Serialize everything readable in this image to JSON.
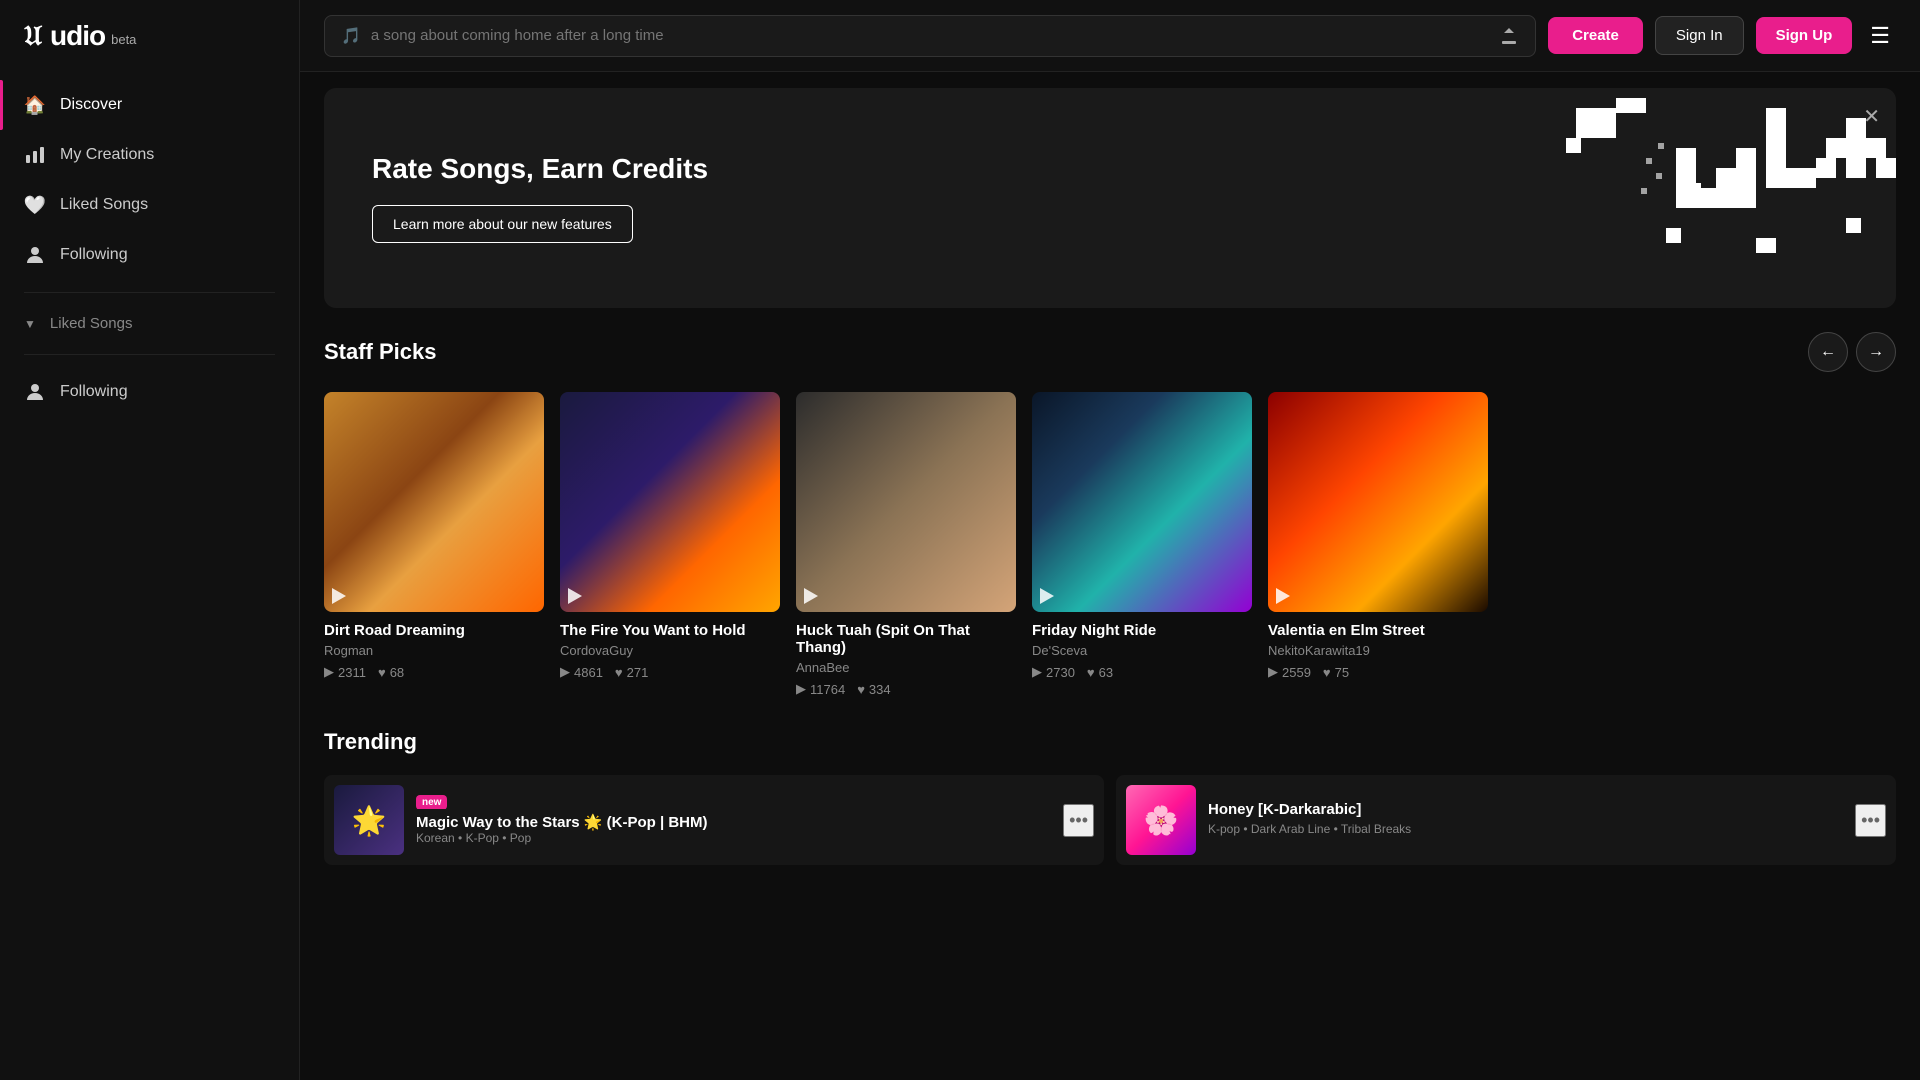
{
  "app": {
    "name": "udio",
    "badge": "beta"
  },
  "topbar": {
    "search_placeholder": "a song about coming home after a long time",
    "create_label": "Create",
    "signin_label": "Sign In",
    "signup_label": "Sign Up"
  },
  "sidebar": {
    "nav_items": [
      {
        "id": "discover",
        "label": "Discover",
        "icon": "🏠",
        "active": true
      },
      {
        "id": "my-creations",
        "label": "My Creations",
        "icon": "📊",
        "active": false
      },
      {
        "id": "liked-songs",
        "label": "Liked Songs",
        "icon": "🤍",
        "active": false
      },
      {
        "id": "following",
        "label": "Following",
        "icon": "👤",
        "active": false
      }
    ],
    "section_collapsed": {
      "label": "Liked Songs",
      "icon": "👤"
    },
    "following_sub": {
      "label": "Following",
      "icon": "👤"
    }
  },
  "hero": {
    "title": "Rate Songs, Earn Credits",
    "button_label": "Learn more about our new features"
  },
  "staff_picks": {
    "title": "Staff Picks",
    "cards": [
      {
        "title": "Dirt Road Dreaming",
        "artist": "Rogman",
        "plays": "2311",
        "likes": "68",
        "thumb_class": "thumb-1"
      },
      {
        "title": "The Fire You Want to Hold",
        "artist": "CordovaGuy",
        "plays": "4861",
        "likes": "271",
        "thumb_class": "thumb-2"
      },
      {
        "title": "Huck Tuah (Spit On That Thang)",
        "artist": "AnnaBee",
        "plays": "11764",
        "likes": "334",
        "thumb_class": "thumb-3"
      },
      {
        "title": "Friday Night Ride",
        "artist": "De'Sceva",
        "plays": "2730",
        "likes": "63",
        "thumb_class": "thumb-4"
      },
      {
        "title": "Valentia en Elm Street",
        "artist": "NekitoKarawita19",
        "plays": "2559",
        "likes": "75",
        "thumb_class": "thumb-5"
      }
    ]
  },
  "trending": {
    "title": "Trending",
    "items": [
      {
        "title": "Magic Way to the Stars 🌟 (K-Pop | BHM)",
        "is_new": true,
        "tags": "Korean • K-Pop • Pop",
        "thumb_class": "trending-thumb-1",
        "emoji": "⭐"
      },
      {
        "title": "Honey [K-Darkarabic]",
        "is_new": false,
        "tags": "K-pop • Dark Arab Line • Tribal Breaks",
        "thumb_class": "trending-thumb-2",
        "emoji": "🌸"
      }
    ]
  }
}
